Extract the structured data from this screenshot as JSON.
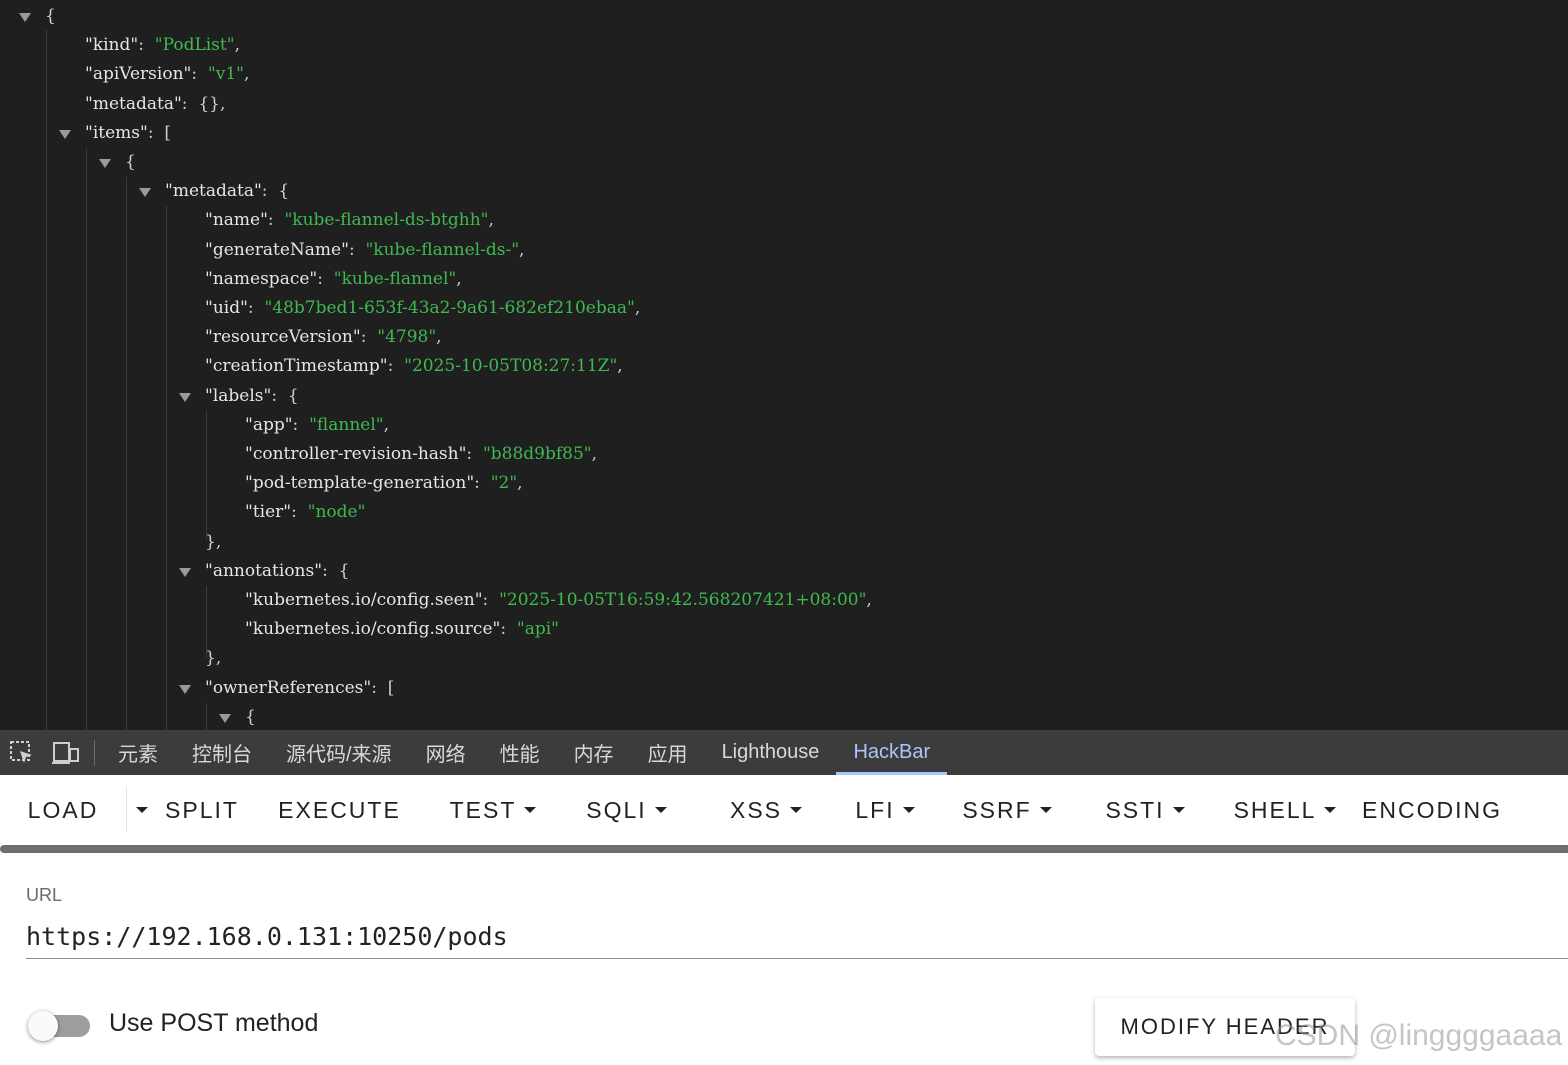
{
  "json_lines": [
    {
      "indent": 0,
      "toggle": true,
      "parts": [
        {
          "c": "p",
          "t": "{"
        }
      ]
    },
    {
      "indent": 1,
      "toggle": false,
      "parts": [
        {
          "c": "k",
          "t": "\"kind\""
        },
        {
          "c": "p",
          "t": ":  "
        },
        {
          "c": "s",
          "t": "\"PodList\""
        },
        {
          "c": "p",
          "t": ","
        }
      ]
    },
    {
      "indent": 1,
      "toggle": false,
      "parts": [
        {
          "c": "k",
          "t": "\"apiVersion\""
        },
        {
          "c": "p",
          "t": ":  "
        },
        {
          "c": "s",
          "t": "\"v1\""
        },
        {
          "c": "p",
          "t": ","
        }
      ]
    },
    {
      "indent": 1,
      "toggle": false,
      "parts": [
        {
          "c": "k",
          "t": "\"metadata\""
        },
        {
          "c": "p",
          "t": ":  {},"
        }
      ]
    },
    {
      "indent": 1,
      "toggle": true,
      "parts": [
        {
          "c": "k",
          "t": "\"items\""
        },
        {
          "c": "p",
          "t": ":  ["
        }
      ]
    },
    {
      "indent": 2,
      "toggle": true,
      "parts": [
        {
          "c": "p",
          "t": "{"
        }
      ]
    },
    {
      "indent": 3,
      "toggle": true,
      "parts": [
        {
          "c": "k",
          "t": "\"metadata\""
        },
        {
          "c": "p",
          "t": ":  {"
        }
      ]
    },
    {
      "indent": 4,
      "toggle": false,
      "parts": [
        {
          "c": "k",
          "t": "\"name\""
        },
        {
          "c": "p",
          "t": ":  "
        },
        {
          "c": "s",
          "t": "\"kube-flannel-ds-btghh\""
        },
        {
          "c": "p",
          "t": ","
        }
      ]
    },
    {
      "indent": 4,
      "toggle": false,
      "parts": [
        {
          "c": "k",
          "t": "\"generateName\""
        },
        {
          "c": "p",
          "t": ":  "
        },
        {
          "c": "s",
          "t": "\"kube-flannel-ds-\""
        },
        {
          "c": "p",
          "t": ","
        }
      ]
    },
    {
      "indent": 4,
      "toggle": false,
      "parts": [
        {
          "c": "k",
          "t": "\"namespace\""
        },
        {
          "c": "p",
          "t": ":  "
        },
        {
          "c": "s",
          "t": "\"kube-flannel\""
        },
        {
          "c": "p",
          "t": ","
        }
      ]
    },
    {
      "indent": 4,
      "toggle": false,
      "parts": [
        {
          "c": "k",
          "t": "\"uid\""
        },
        {
          "c": "p",
          "t": ":  "
        },
        {
          "c": "s",
          "t": "\"48b7bed1-653f-43a2-9a61-682ef210ebaa\""
        },
        {
          "c": "p",
          "t": ","
        }
      ]
    },
    {
      "indent": 4,
      "toggle": false,
      "parts": [
        {
          "c": "k",
          "t": "\"resourceVersion\""
        },
        {
          "c": "p",
          "t": ":  "
        },
        {
          "c": "s",
          "t": "\"4798\""
        },
        {
          "c": "p",
          "t": ","
        }
      ]
    },
    {
      "indent": 4,
      "toggle": false,
      "parts": [
        {
          "c": "k",
          "t": "\"creationTimestamp\""
        },
        {
          "c": "p",
          "t": ":  "
        },
        {
          "c": "s",
          "t": "\"2025-10-05T08:27:11Z\""
        },
        {
          "c": "p",
          "t": ","
        }
      ]
    },
    {
      "indent": 4,
      "toggle": true,
      "parts": [
        {
          "c": "k",
          "t": "\"labels\""
        },
        {
          "c": "p",
          "t": ":  {"
        }
      ]
    },
    {
      "indent": 5,
      "toggle": false,
      "parts": [
        {
          "c": "k",
          "t": "\"app\""
        },
        {
          "c": "p",
          "t": ":  "
        },
        {
          "c": "s",
          "t": "\"flannel\""
        },
        {
          "c": "p",
          "t": ","
        }
      ]
    },
    {
      "indent": 5,
      "toggle": false,
      "parts": [
        {
          "c": "k",
          "t": "\"controller-revision-hash\""
        },
        {
          "c": "p",
          "t": ":  "
        },
        {
          "c": "s",
          "t": "\"b88d9bf85\""
        },
        {
          "c": "p",
          "t": ","
        }
      ]
    },
    {
      "indent": 5,
      "toggle": false,
      "parts": [
        {
          "c": "k",
          "t": "\"pod-template-generation\""
        },
        {
          "c": "p",
          "t": ":  "
        },
        {
          "c": "s",
          "t": "\"2\""
        },
        {
          "c": "p",
          "t": ","
        }
      ]
    },
    {
      "indent": 5,
      "toggle": false,
      "parts": [
        {
          "c": "k",
          "t": "\"tier\""
        },
        {
          "c": "p",
          "t": ":  "
        },
        {
          "c": "s",
          "t": "\"node\""
        }
      ]
    },
    {
      "indent": 4,
      "toggle": false,
      "parts": [
        {
          "c": "p",
          "t": "},"
        }
      ]
    },
    {
      "indent": 4,
      "toggle": true,
      "parts": [
        {
          "c": "k",
          "t": "\"annotations\""
        },
        {
          "c": "p",
          "t": ":  {"
        }
      ]
    },
    {
      "indent": 5,
      "toggle": false,
      "parts": [
        {
          "c": "k",
          "t": "\"kubernetes.io/config.seen\""
        },
        {
          "c": "p",
          "t": ":  "
        },
        {
          "c": "s",
          "t": "\"2025-10-05T16:59:42.568207421+08:00\""
        },
        {
          "c": "p",
          "t": ","
        }
      ]
    },
    {
      "indent": 5,
      "toggle": false,
      "parts": [
        {
          "c": "k",
          "t": "\"kubernetes.io/config.source\""
        },
        {
          "c": "p",
          "t": ":  "
        },
        {
          "c": "s",
          "t": "\"api\""
        }
      ]
    },
    {
      "indent": 4,
      "toggle": false,
      "parts": [
        {
          "c": "p",
          "t": "},"
        }
      ]
    },
    {
      "indent": 4,
      "toggle": true,
      "parts": [
        {
          "c": "k",
          "t": "\"ownerReferences\""
        },
        {
          "c": "p",
          "t": ":  ["
        }
      ]
    },
    {
      "indent": 5,
      "toggle": true,
      "parts": [
        {
          "c": "p",
          "t": "{"
        }
      ]
    }
  ],
  "devtools": {
    "tabs": [
      {
        "label": "元素"
      },
      {
        "label": "控制台"
      },
      {
        "label": "源代码/来源"
      },
      {
        "label": "网络"
      },
      {
        "label": "性能"
      },
      {
        "label": "内存"
      },
      {
        "label": "应用"
      },
      {
        "label": "Lighthouse"
      },
      {
        "label": "HackBar"
      }
    ],
    "active_tab": "HackBar",
    "icons": [
      "inspect-element-icon",
      "device-toolbar-icon"
    ]
  },
  "hackbar": {
    "toolbar": [
      {
        "label": "LOAD",
        "dropdown": false
      },
      {
        "label": "",
        "dropdown": true
      },
      {
        "label": "SPLIT",
        "dropdown": false
      },
      {
        "label": "EXECUTE",
        "dropdown": false
      },
      {
        "label": "TEST",
        "dropdown": true
      },
      {
        "label": "SQLI",
        "dropdown": true
      },
      {
        "label": "XSS",
        "dropdown": true
      },
      {
        "label": "LFI",
        "dropdown": true
      },
      {
        "label": "SSRF",
        "dropdown": true
      },
      {
        "label": "SSTI",
        "dropdown": true
      },
      {
        "label": "SHELL",
        "dropdown": true
      },
      {
        "label": "ENCODING",
        "dropdown": false
      }
    ],
    "url_label": "URL",
    "url_value": "https://192.168.0.131:10250/pods",
    "post_method_label": "Use POST method",
    "post_method_enabled": false,
    "modify_header_label": "MODIFY HEADER"
  },
  "watermark": "CSDN @linggggaaaa",
  "colors": {
    "json_key": "#e6e6e6",
    "json_string": "#3fb950",
    "active_tab": "#a8c7fa",
    "viewer_bg": "#1f1f1f"
  }
}
